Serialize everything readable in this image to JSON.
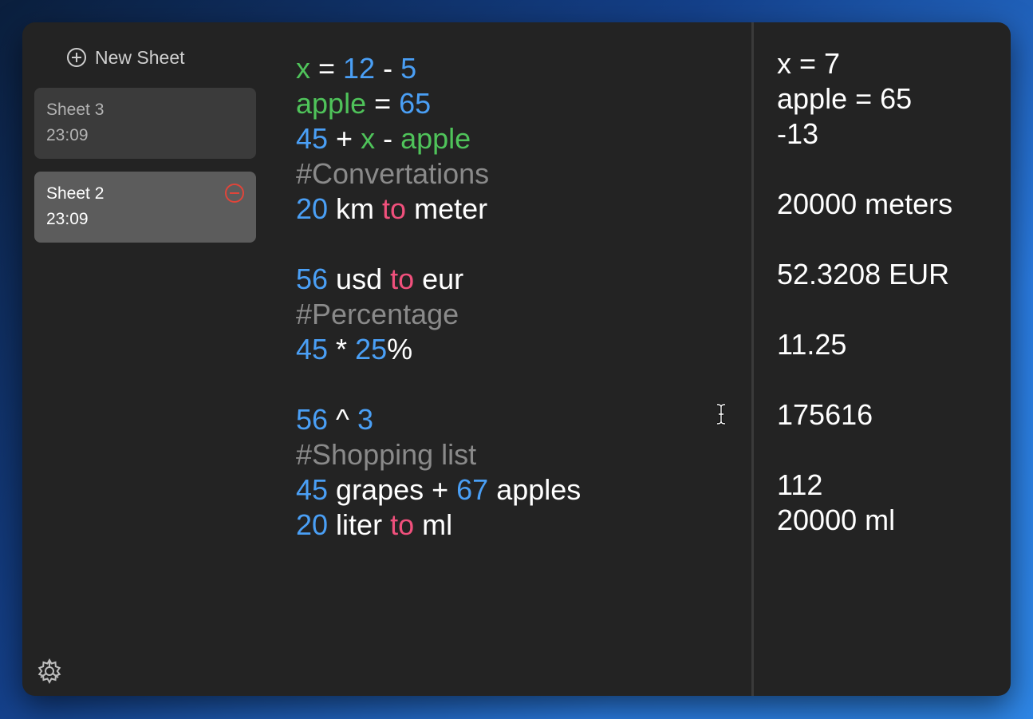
{
  "sidebar": {
    "new_sheet_label": "New Sheet",
    "sheets": [
      {
        "name": "Sheet 3",
        "time": "23:09"
      },
      {
        "name": "Sheet 2",
        "time": "23:09"
      }
    ]
  },
  "editor": {
    "lines": [
      [
        {
          "t": "x",
          "c": "var"
        },
        {
          "t": " = ",
          "c": "op"
        },
        {
          "t": "12",
          "c": "num"
        },
        {
          "t": " - ",
          "c": "op"
        },
        {
          "t": "5",
          "c": "num"
        }
      ],
      [
        {
          "t": "apple",
          "c": "var"
        },
        {
          "t": " = ",
          "c": "op"
        },
        {
          "t": "65",
          "c": "num"
        }
      ],
      [
        {
          "t": "45",
          "c": "num"
        },
        {
          "t": " + ",
          "c": "op"
        },
        {
          "t": "x",
          "c": "var"
        },
        {
          "t": " - ",
          "c": "op"
        },
        {
          "t": "apple",
          "c": "var"
        }
      ],
      [
        {
          "t": "#Convertations",
          "c": "comment"
        }
      ],
      [
        {
          "t": "20",
          "c": "num"
        },
        {
          "t": " km ",
          "c": "op"
        },
        {
          "t": "to",
          "c": "kw"
        },
        {
          "t": " meter",
          "c": "op"
        }
      ],
      [],
      [
        {
          "t": "56",
          "c": "num"
        },
        {
          "t": " usd ",
          "c": "op"
        },
        {
          "t": "to",
          "c": "kw"
        },
        {
          "t": " eur",
          "c": "op"
        }
      ],
      [
        {
          "t": "#Percentage",
          "c": "comment"
        }
      ],
      [
        {
          "t": "45",
          "c": "num"
        },
        {
          "t": " * ",
          "c": "op"
        },
        {
          "t": "25",
          "c": "num"
        },
        {
          "t": "%",
          "c": "op"
        }
      ],
      [],
      [
        {
          "t": "56",
          "c": "num"
        },
        {
          "t": " ^ ",
          "c": "op"
        },
        {
          "t": "3",
          "c": "num"
        }
      ],
      [
        {
          "t": "#Shopping list",
          "c": "comment"
        }
      ],
      [
        {
          "t": "45",
          "c": "num"
        },
        {
          "t": " grapes + ",
          "c": "op"
        },
        {
          "t": "67",
          "c": "num"
        },
        {
          "t": " apples",
          "c": "op"
        }
      ],
      [
        {
          "t": "20",
          "c": "num"
        },
        {
          "t": " liter ",
          "c": "op"
        },
        {
          "t": "to",
          "c": "kw"
        },
        {
          "t": " ml",
          "c": "op"
        }
      ]
    ]
  },
  "results": [
    "x = 7",
    "apple = 65",
    "-13",
    "",
    "20000 meters",
    "",
    "52.3208 EUR",
    "",
    "11.25",
    "",
    "175616",
    "",
    "112",
    "20000 ml"
  ],
  "colors": {
    "number": "#4a9ff5",
    "variable": "#4fc35a",
    "keyword": "#f0507c",
    "comment": "#8a8a8a",
    "delete": "#e0453a"
  },
  "icons": {
    "new_sheet": "plus-circle-icon",
    "delete": "minus-circle-icon",
    "settings": "gear-icon",
    "cursor": "text-cursor-icon"
  }
}
